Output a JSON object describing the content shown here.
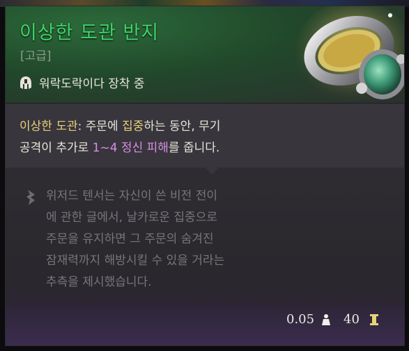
{
  "tooltip": {
    "name": "이상한 도관 반지",
    "rarity": "[고급]",
    "equipped_text": "워락도락이다 장착 중",
    "effect": {
      "label": "이상한 도관",
      "part1": ": 주문에 ",
      "highlight": "집중",
      "part2": "하는 동안, 무기",
      "line2_prefix": "공격이 추가로 ",
      "damage": "1~4 정신 피해",
      "line2_suffix": "를 줍니다."
    },
    "lore": [
      "위저드 텐서는 자신이 쓴 비전 전이",
      "에 관한 글에서, 날카로운 집중으로",
      "주문을 유지하면 그 주문의 숨겨진",
      "잠재력까지 해방시킬 수 있을 거라는",
      "추측을 제시했습니다."
    ],
    "weight": "0.05",
    "value": "40"
  },
  "icons": {
    "equipped": "helmet-icon",
    "lore": "quill-icon",
    "weight": "weight-icon",
    "value": "coin-icon",
    "item": "ring-image"
  },
  "colors": {
    "name": "#3fd46a",
    "keyword": "#e8cf7c",
    "damage": "#d98ee6"
  }
}
